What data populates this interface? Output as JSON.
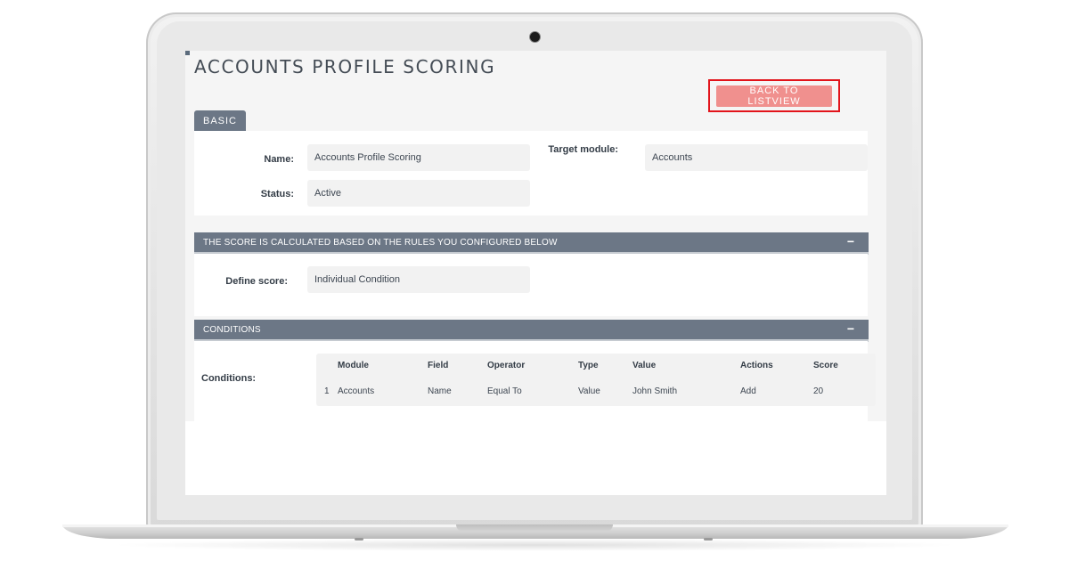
{
  "page": {
    "title": "ACCOUNTS PROFILE SCORING",
    "back_button": "BACK TO LISTVIEW"
  },
  "basic": {
    "tab_label": "BASIC",
    "name_label": "Name:",
    "name_value": "Accounts Profile Scoring",
    "status_label": "Status:",
    "status_value": "Active",
    "target_label": "Target module:",
    "target_value": "Accounts"
  },
  "score_section": {
    "header": "THE SCORE IS CALCULATED BASED ON THE RULES YOU CONFIGURED BELOW",
    "collapse_icon": "minus-icon",
    "define_label": "Define score:",
    "define_value": "Individual Condition"
  },
  "conditions_section": {
    "header": "CONDITIONS",
    "collapse_icon": "minus-icon",
    "label": "Conditions:",
    "columns": [
      "Module",
      "Field",
      "Operator",
      "Type",
      "Value",
      "Actions",
      "Score"
    ],
    "rows": [
      {
        "index": "1",
        "module": "Accounts",
        "field": "Name",
        "operator": "Equal To",
        "type": "Value",
        "value": "John Smith",
        "actions": "Add",
        "score": "20"
      }
    ]
  },
  "colors": {
    "header_bg": "#6c7786",
    "button_bg": "#f0908e",
    "highlight_border": "#e2141b"
  }
}
